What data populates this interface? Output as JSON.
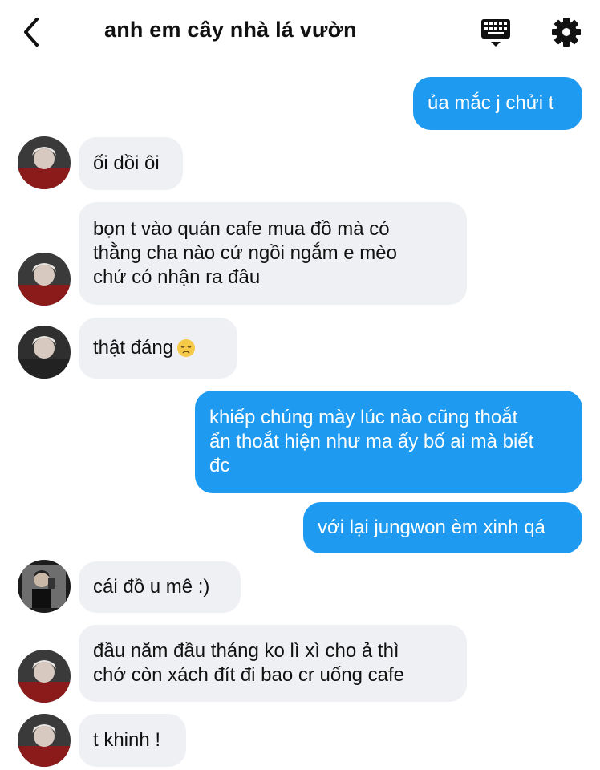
{
  "header": {
    "title": "anh em cây nhà lá vườn",
    "back_icon": "chevron-left-icon",
    "keyboard_icon": "keyboard-icon",
    "settings_icon": "gear-icon"
  },
  "colors": {
    "outgoing_bubble": "#1e9bf0",
    "incoming_bubble": "#eef0f3",
    "text": "#111111"
  },
  "messages": [
    {
      "direction": "out",
      "text": "ủa mắc j chửi t"
    },
    {
      "direction": "in",
      "text": "ối dồi ôi"
    },
    {
      "direction": "in",
      "text": "bọn t vào quán cafe mua đồ mà  có\nthằng cha nào cứ ngồi ngắm e mèo\nchứ có nhận ra đâu"
    },
    {
      "direction": "in",
      "text": "thật đáng",
      "emoji": "disappointed-face-emoji"
    },
    {
      "direction": "out",
      "text": "khiếp chúng mày lúc nào cũng thoắt\nẩn thoắt hiện như ma ấy bố ai mà biết\nđc"
    },
    {
      "direction": "out",
      "text": "với lại jungwon èm xinh qá"
    },
    {
      "direction": "in",
      "text": "cái đồ u mê :)"
    },
    {
      "direction": "in",
      "text": "đầu năm đầu tháng ko lì xì cho ả thì\nchớ còn xách đít đi bao cr uống cafe"
    },
    {
      "direction": "in",
      "text": "t khinh !"
    }
  ]
}
